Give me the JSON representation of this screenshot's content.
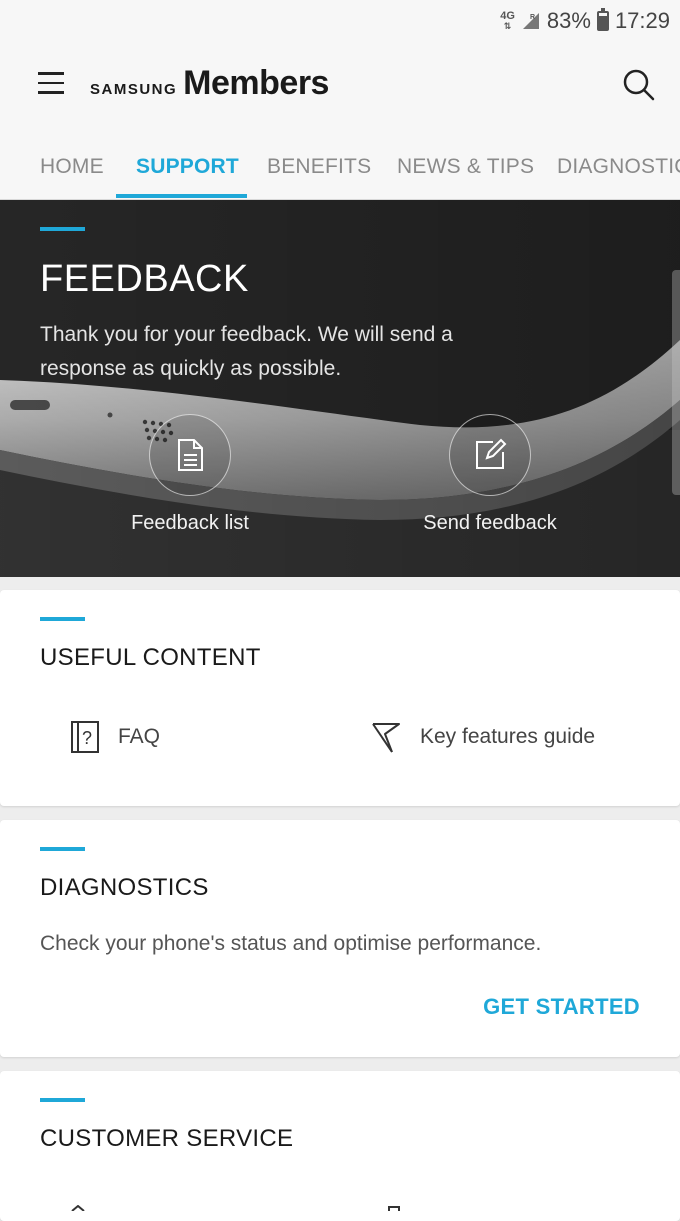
{
  "status_bar": {
    "network": "4G",
    "roaming": "R",
    "battery": "83%",
    "time": "17:29"
  },
  "app_bar": {
    "brand_small": "SAMSUNG",
    "brand_large": "Members"
  },
  "tabs": [
    {
      "label": "HOME",
      "active": false
    },
    {
      "label": "SUPPORT",
      "active": true
    },
    {
      "label": "BENEFITS",
      "active": false
    },
    {
      "label": "NEWS & TIPS",
      "active": false
    },
    {
      "label": "DIAGNOSTICS",
      "active": false
    }
  ],
  "feedback": {
    "title": "FEEDBACK",
    "description": "Thank you for your feedback. We will send a response as quickly as possible.",
    "actions": [
      {
        "label": "Feedback list",
        "icon": "document-icon"
      },
      {
        "label": "Send feedback",
        "icon": "edit-icon"
      }
    ]
  },
  "useful_content": {
    "heading": "USEFUL CONTENT",
    "items": [
      {
        "label": "FAQ",
        "icon": "faq-icon"
      },
      {
        "label": "Key features guide",
        "icon": "flag-icon"
      }
    ]
  },
  "diagnostics": {
    "heading": "DIAGNOSTICS",
    "text": "Check your phone's status and optimise performance.",
    "cta": "GET STARTED"
  },
  "customer_service": {
    "heading": "CUSTOMER SERVICE"
  },
  "colors": {
    "accent": "#1fa8d8",
    "background": "#ededed",
    "bar": "#f7f7f7"
  }
}
